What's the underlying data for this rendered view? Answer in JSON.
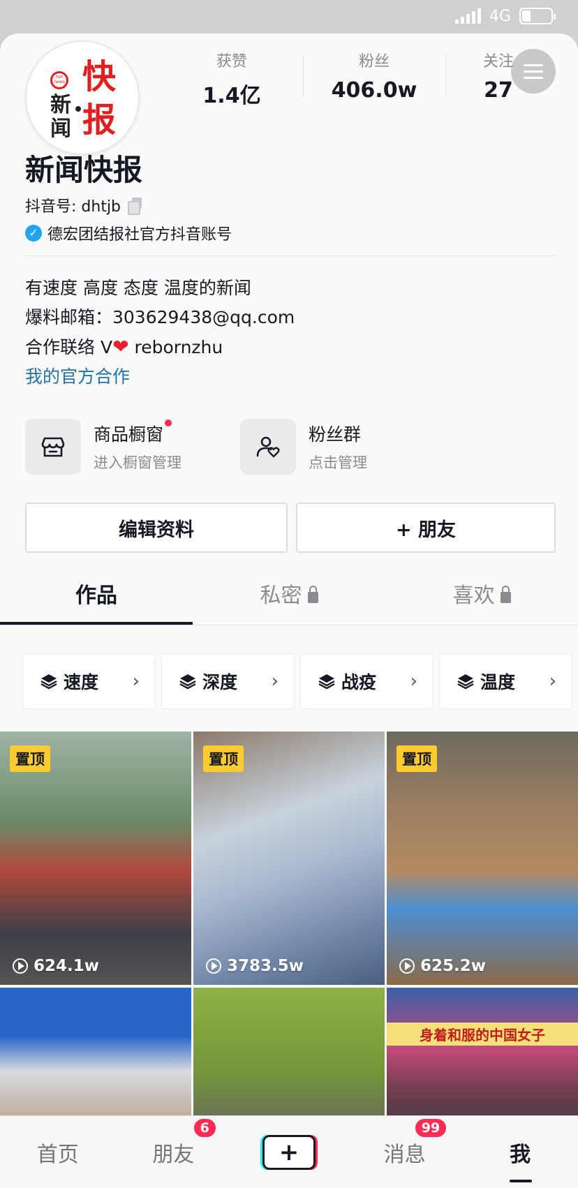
{
  "status_bar": {
    "network": "4G"
  },
  "profile": {
    "avatar_text": {
      "tiny": "hot news",
      "left_top": "新",
      "left_bottom": "闻",
      "right_top": "快",
      "right_bottom": "报"
    },
    "nickname": "新闻快报",
    "douyin_id": "抖音号: dhtjb",
    "verification": "德宏团结报社官方抖音账号",
    "bio_lines": [
      "有速度 高度 态度 温度的新闻",
      "爆料邮箱：303629438@qq.com"
    ],
    "contact_prefix": "合作联络 V",
    "contact_suffix": " rebornzhu",
    "official_link": "我的官方合作"
  },
  "stats": [
    {
      "label": "获赞",
      "value": "1.4亿"
    },
    {
      "label": "粉丝",
      "value": "406.0w"
    },
    {
      "label": "关注",
      "value": "27"
    }
  ],
  "entries": [
    {
      "title": "商品橱窗",
      "subtitle": "进入橱窗管理",
      "has_dot": true
    },
    {
      "title": "粉丝群",
      "subtitle": "点击管理",
      "has_dot": false
    }
  ],
  "buttons": {
    "edit": "编辑资料",
    "add_friend": "+ 朋友"
  },
  "tabs": [
    {
      "label": "作品",
      "active": true,
      "locked": false
    },
    {
      "label": "私密",
      "active": false,
      "locked": true
    },
    {
      "label": "喜欢",
      "active": false,
      "locked": true
    }
  ],
  "collections": [
    "速度",
    "深度",
    "战疫",
    "温度"
  ],
  "videos": [
    {
      "pinned": "置顶",
      "views": "624.1w"
    },
    {
      "pinned": "置顶",
      "views": "3783.5w"
    },
    {
      "pinned": "置顶",
      "views": "625.2w"
    },
    {
      "caption": ""
    },
    {
      "caption": ""
    },
    {
      "caption": "身着和服的中国女子"
    }
  ],
  "bottom_nav": [
    {
      "label": "首页"
    },
    {
      "label": "朋友",
      "badge": "6"
    },
    {
      "label": "+"
    },
    {
      "label": "消息",
      "badge": "99"
    },
    {
      "label": "我",
      "active": true
    }
  ],
  "colors": {
    "accent_red": "#fe2c55",
    "link_blue": "#1e73a8",
    "pin_yellow": "#fecc2f",
    "verify_blue": "#20a4f3"
  }
}
